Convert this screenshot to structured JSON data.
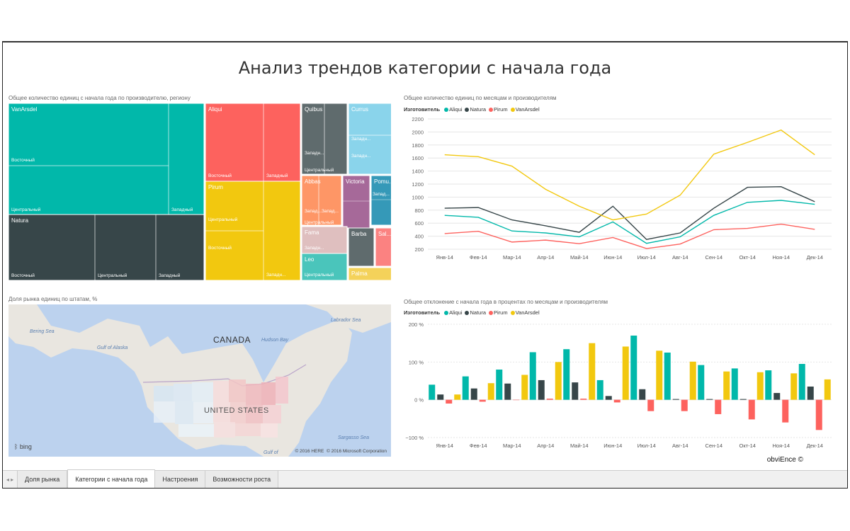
{
  "title": "Анализ трендов категории с начала года",
  "brand": "obviEnce ©",
  "colors": {
    "aliqui": "#01B8AA",
    "natura": "#374649",
    "pirum": "#FD625E",
    "vanarsdel": "#F2C80F"
  },
  "treemap": {
    "title": "Общее количество единиц с начала года по производителю, региону",
    "labels": {
      "vanarsdel": "VanArsdel",
      "aliqui": "Aliqui",
      "quibus": "Quibus",
      "currus": "Currus",
      "natura": "Natura",
      "pirum": "Pirum",
      "abbas": "Abbas",
      "victoria": "Victoria",
      "pomu": "Pomu...",
      "fama": "Fama",
      "barba": "Barba",
      "sal": "Sal...",
      "leo": "Leo",
      "palma": "Palma",
      "east": "Восточный",
      "central": "Центральный",
      "west": "Западный",
      "central_abbr": "Центральн...",
      "west_abbr": "Западн...",
      "west_short": "Запад..."
    }
  },
  "map": {
    "title": "Доля рынка единиц по штатам, %",
    "labels": {
      "canada": "CANADA",
      "us": "UNITED STATES",
      "bering": "Bering Sea",
      "alaska": "Gulf of Alaska",
      "hudson": "Hudson Bay",
      "labrador": "Labrador Sea",
      "sargasso": "Sargasso Sea",
      "gulf": "Gulf of"
    },
    "copyright1": "© 2016 HERE",
    "copyright2": "© 2016 Microsoft Corporation",
    "bing": "bing"
  },
  "legend_label": "Изготовитель",
  "series_names": [
    "Aliqui",
    "Natura",
    "Pirum",
    "VanArsdel"
  ],
  "chart_data": [
    {
      "type": "line",
      "title": "Общее количество единиц по месяцам и производителям",
      "categories": [
        "Янв-14",
        "Фев-14",
        "Мар-14",
        "Апр-14",
        "Май-14",
        "Июн-14",
        "Июл-14",
        "Авг-14",
        "Сен-14",
        "Окт-14",
        "Ноя-14",
        "Дек-14"
      ],
      "ylim": [
        200,
        2200
      ],
      "yticks": [
        200,
        400,
        600,
        800,
        1000,
        1200,
        1400,
        1600,
        1800,
        2000,
        2200
      ],
      "series": [
        {
          "name": "Aliqui",
          "values": [
            720,
            690,
            480,
            450,
            390,
            620,
            290,
            390,
            720,
            920,
            950,
            890
          ]
        },
        {
          "name": "Natura",
          "values": [
            830,
            840,
            650,
            560,
            460,
            860,
            350,
            450,
            830,
            1150,
            1160,
            930
          ]
        },
        {
          "name": "Pirum",
          "values": [
            440,
            475,
            310,
            340,
            285,
            380,
            210,
            280,
            500,
            520,
            585,
            505
          ]
        },
        {
          "name": "VanArsdel",
          "values": [
            1650,
            1620,
            1475,
            1120,
            860,
            650,
            740,
            1030,
            1660,
            1840,
            2030,
            1650
          ]
        }
      ]
    },
    {
      "type": "bar",
      "title": "Общее отклонение с начала года в процентах по месяцам и производителям",
      "categories": [
        "Янв-14",
        "Фев-14",
        "Мар-14",
        "Апр-14",
        "Май-14",
        "Июн-14",
        "Июл-14",
        "Авг-14",
        "Сен-14",
        "Окт-14",
        "Ноя-14",
        "Дек-14"
      ],
      "ylim": [
        -100,
        200
      ],
      "yticks": [
        {
          "v": 200,
          "t": "200 %"
        },
        {
          "v": 100,
          "t": "100 %"
        },
        {
          "v": 0,
          "t": "0 %"
        },
        {
          "v": -100,
          "t": "−100 %"
        }
      ],
      "series": [
        {
          "name": "Aliqui",
          "values": [
            40,
            62,
            80,
            126,
            134,
            52,
            170,
            125,
            92,
            83,
            78,
            95
          ]
        },
        {
          "name": "Natura",
          "values": [
            14,
            30,
            43,
            52,
            46,
            10,
            28,
            2,
            2,
            2,
            18,
            35
          ]
        },
        {
          "name": "Pirum",
          "values": [
            -10,
            -5,
            0,
            3,
            3,
            -7,
            -30,
            -30,
            -38,
            -52,
            -60,
            -80
          ]
        },
        {
          "name": "VanArsdel",
          "values": [
            14,
            44,
            66,
            100,
            150,
            141,
            130,
            101,
            75,
            73,
            70,
            54
          ]
        }
      ]
    }
  ],
  "tabs": [
    {
      "label": "Доля рынка",
      "active": false
    },
    {
      "label": "Категории с начала года",
      "active": true
    },
    {
      "label": "Настроения",
      "active": false
    },
    {
      "label": "Возможности роста",
      "active": false
    }
  ]
}
